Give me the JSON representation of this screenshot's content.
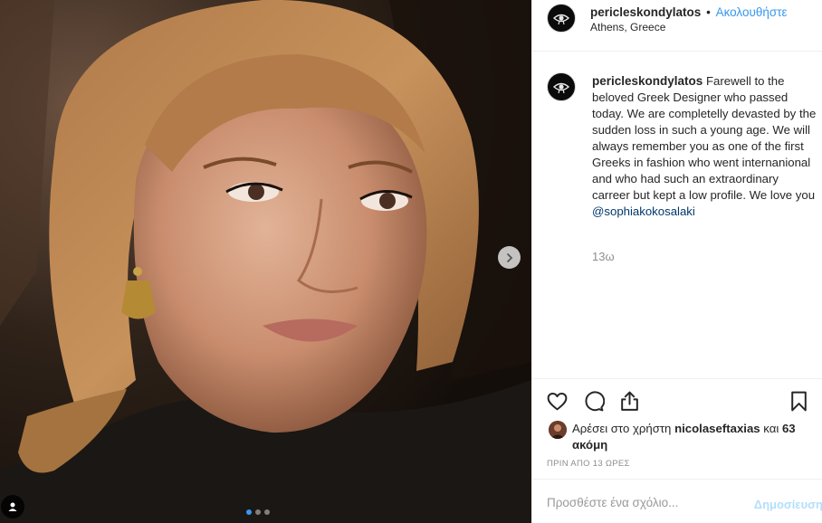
{
  "header": {
    "username": "pericleskondylatos",
    "separator": "•",
    "follow_label": "Ακολουθήστε",
    "location": "Athens, Greece"
  },
  "caption": {
    "username": "pericleskondylatos",
    "text": "Farewell to the beloved Greek Designer who passed today. We are completelly devasted by the sudden loss in such a young age. We will always remember you as one of the first Greeks in fashion who went internanional and who had such an extraordinary carreer but kept a low profile. We love you",
    "mention": "@sophiakokosalaki",
    "time_ago": "13ω"
  },
  "likes": {
    "prefix": "Αρέσει στο χρήστη",
    "liker": "nicolaseftaxias",
    "conjunction": "και",
    "others": "63 ακόμη"
  },
  "post_date": "ΠΡΙΝ ΑΠΟ 13 ΩΡΕΣ",
  "comment_box": {
    "placeholder": "Προσθέστε ένα σχόλιο...",
    "publish_label": "Δημοσίευση"
  },
  "carousel": {
    "slide_count": 3,
    "active_index": 0
  },
  "icons": {
    "like": "heart-icon",
    "comment": "comment-bubble-icon",
    "share": "share-icon",
    "save": "bookmark-icon",
    "next": "chevron-right-icon",
    "tags": "user-tag-icon"
  },
  "colors": {
    "link_blue": "#3897f0",
    "mention_blue": "#00376b",
    "muted": "#8e8e8e",
    "publish_disabled": "#b2dffc"
  }
}
